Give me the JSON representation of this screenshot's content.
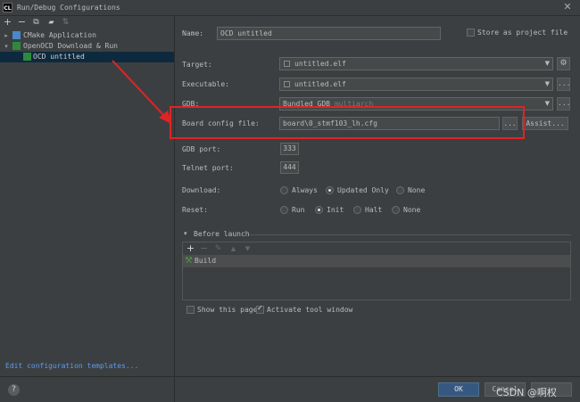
{
  "window": {
    "title": "Run/Debug Configurations",
    "app_icon_text": "CL",
    "close": "✕"
  },
  "toolbar": {
    "add": "+",
    "remove": "−",
    "copy": "⧉",
    "folder": "▰",
    "sort": "⇅"
  },
  "tree": {
    "items": [
      {
        "label": "CMake Application",
        "arrow": "▸"
      },
      {
        "label": "OpenOCD Download & Run",
        "arrow": "▾"
      },
      {
        "label": "OCD untitled"
      }
    ]
  },
  "edit_templates": "Edit configuration templates...",
  "help": "?",
  "form": {
    "name_label": "Name:",
    "name_value": "OCD untitled",
    "store_label": "Store as project file",
    "target_label": "Target:",
    "target_value": "untitled.elf",
    "executable_label": "Executable:",
    "executable_value": "untitled.elf",
    "gdb_label": "GDB:",
    "gdb_value": "Bundled GDB",
    "gdb_hint": "multiarch",
    "board_label": "Board config file:",
    "board_value": "board\\0_stmf103_lh.cfg",
    "ellipsis": "...",
    "assist": "Assist...",
    "gdb_port_label": "GDB port:",
    "gdb_port_value": "333",
    "telnet_port_label": "Telnet port:",
    "telnet_port_value": "444",
    "download_label": "Download:",
    "download_options": [
      "Always",
      "Updated Only",
      "None"
    ],
    "download_selected": "Updated Only",
    "reset_label": "Reset:",
    "reset_options": [
      "Run",
      "Init",
      "Halt",
      "None"
    ],
    "reset_selected": "Init"
  },
  "before_launch": {
    "title": "Before launch",
    "toggle": "▾",
    "toolbar": [
      "+",
      "−",
      "✎",
      "▲",
      "▼"
    ],
    "items": [
      "Build"
    ]
  },
  "options": {
    "show_page": "Show this page",
    "activate_window": "Activate tool window"
  },
  "buttons": {
    "ok": "OK",
    "cancel": "Cancel"
  },
  "watermark": "CSDN @啊权"
}
